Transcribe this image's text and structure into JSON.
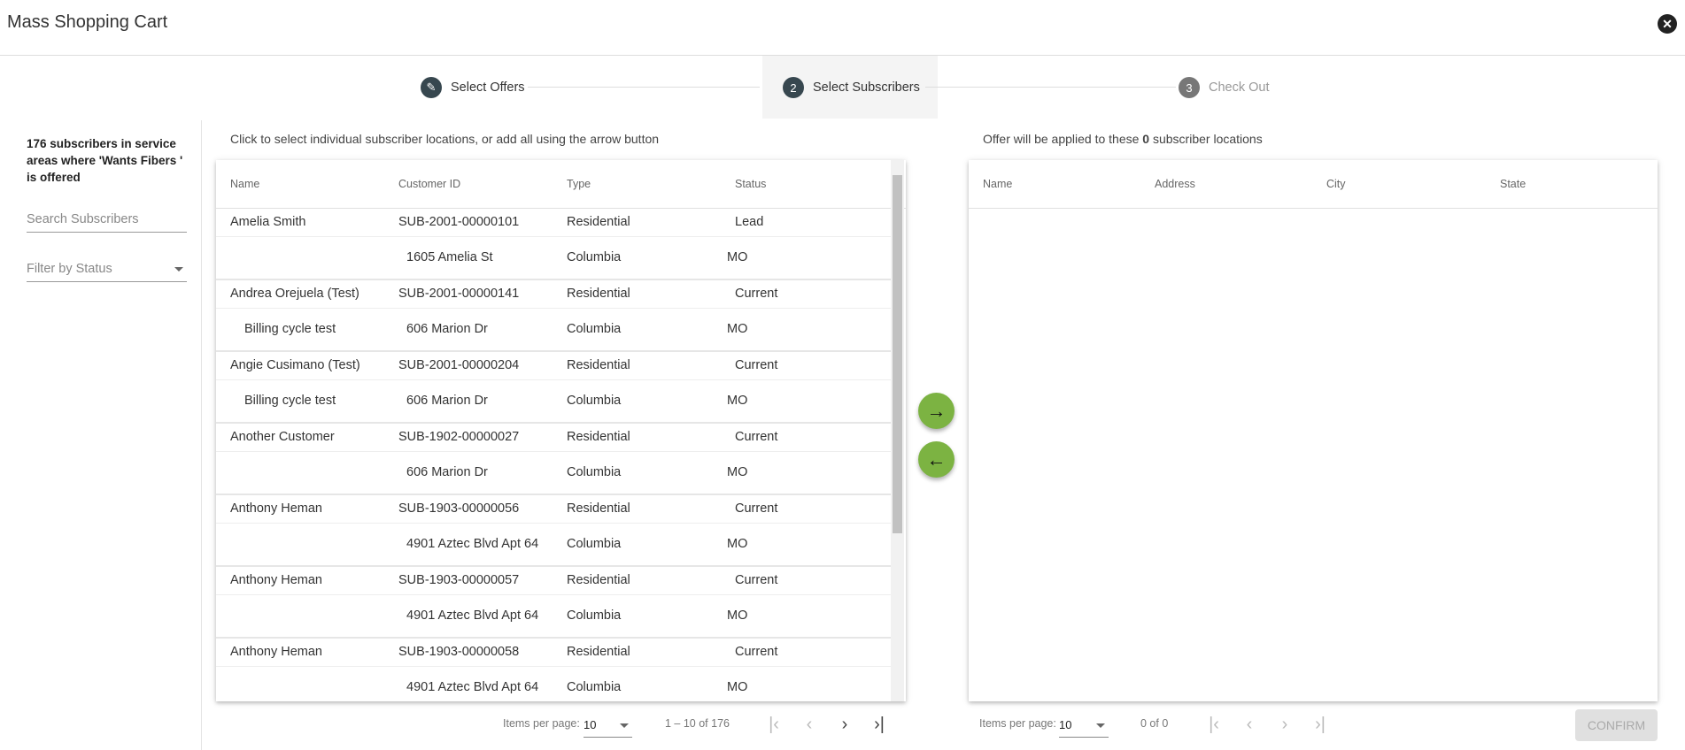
{
  "app": {
    "title": "Mass Shopping Cart",
    "close_icon": "close-circle-icon"
  },
  "stepper": {
    "steps": [
      {
        "number": "",
        "label": "Select Offers",
        "icon": "pencil-icon",
        "state": "done"
      },
      {
        "number": "2",
        "label": "Select Subscribers",
        "state": "active"
      },
      {
        "number": "3",
        "label": "Check Out",
        "state": "inactive"
      }
    ]
  },
  "sidebar": {
    "summary": "176 subscribers in service areas where 'Wants Fibers ' is offered",
    "search_placeholder": "Search Subscribers",
    "filter_placeholder": "Filter by Status"
  },
  "left": {
    "instruction": "Click to select individual subscriber locations, or add all using the arrow button",
    "columns": [
      "Name",
      "Customer ID",
      "Type",
      "Status"
    ],
    "rows": [
      {
        "name": "Amelia Smith",
        "id": "SUB-2001-00000101",
        "type": "Residential",
        "status": "Lead",
        "name2": "",
        "address": "1605 Amelia St",
        "city": "Columbia",
        "state": "MO"
      },
      {
        "name": "Andrea Orejuela (Test)",
        "id": "SUB-2001-00000141",
        "type": "Residential",
        "status": "Current",
        "name2": "Billing cycle test",
        "address": "606 Marion Dr",
        "city": "Columbia",
        "state": "MO"
      },
      {
        "name": "Angie Cusimano (Test)",
        "id": "SUB-2001-00000204",
        "type": "Residential",
        "status": "Current",
        "name2": "Billing cycle test",
        "address": "606 Marion Dr",
        "city": "Columbia",
        "state": "MO"
      },
      {
        "name": "Another Customer",
        "id": "SUB-1902-00000027",
        "type": "Residential",
        "status": "Current",
        "name2": "",
        "address": "606 Marion Dr",
        "city": "Columbia",
        "state": "MO"
      },
      {
        "name": "Anthony Heman",
        "id": "SUB-1903-00000056",
        "type": "Residential",
        "status": "Current",
        "name2": "",
        "address": "4901 Aztec Blvd Apt 64",
        "city": "Columbia",
        "state": "MO"
      },
      {
        "name": "Anthony Heman",
        "id": "SUB-1903-00000057",
        "type": "Residential",
        "status": "Current",
        "name2": "",
        "address": "4901 Aztec Blvd Apt 64",
        "city": "Columbia",
        "state": "MO"
      },
      {
        "name": "Anthony Heman",
        "id": "SUB-1903-00000058",
        "type": "Residential",
        "status": "Current",
        "name2": "",
        "address": "4901 Aztec Blvd Apt 64",
        "city": "Columbia",
        "state": "MO"
      }
    ],
    "paginator": {
      "items_label": "Items per page:",
      "page_size": "10",
      "range": "1 – 10 of 176"
    }
  },
  "right": {
    "instruction_pre": "Offer will be applied to these ",
    "instruction_count": "0",
    "instruction_post": " subscriber locations",
    "columns": [
      "Name",
      "Address",
      "City",
      "State"
    ],
    "paginator": {
      "items_label": "Items per page:",
      "page_size": "10",
      "range": "0 of 0"
    },
    "confirm_label": "CONFIRM"
  },
  "transfer": {
    "add_icon": "arrow-right-icon",
    "remove_icon": "arrow-left-icon",
    "accent": "#7cb342"
  }
}
